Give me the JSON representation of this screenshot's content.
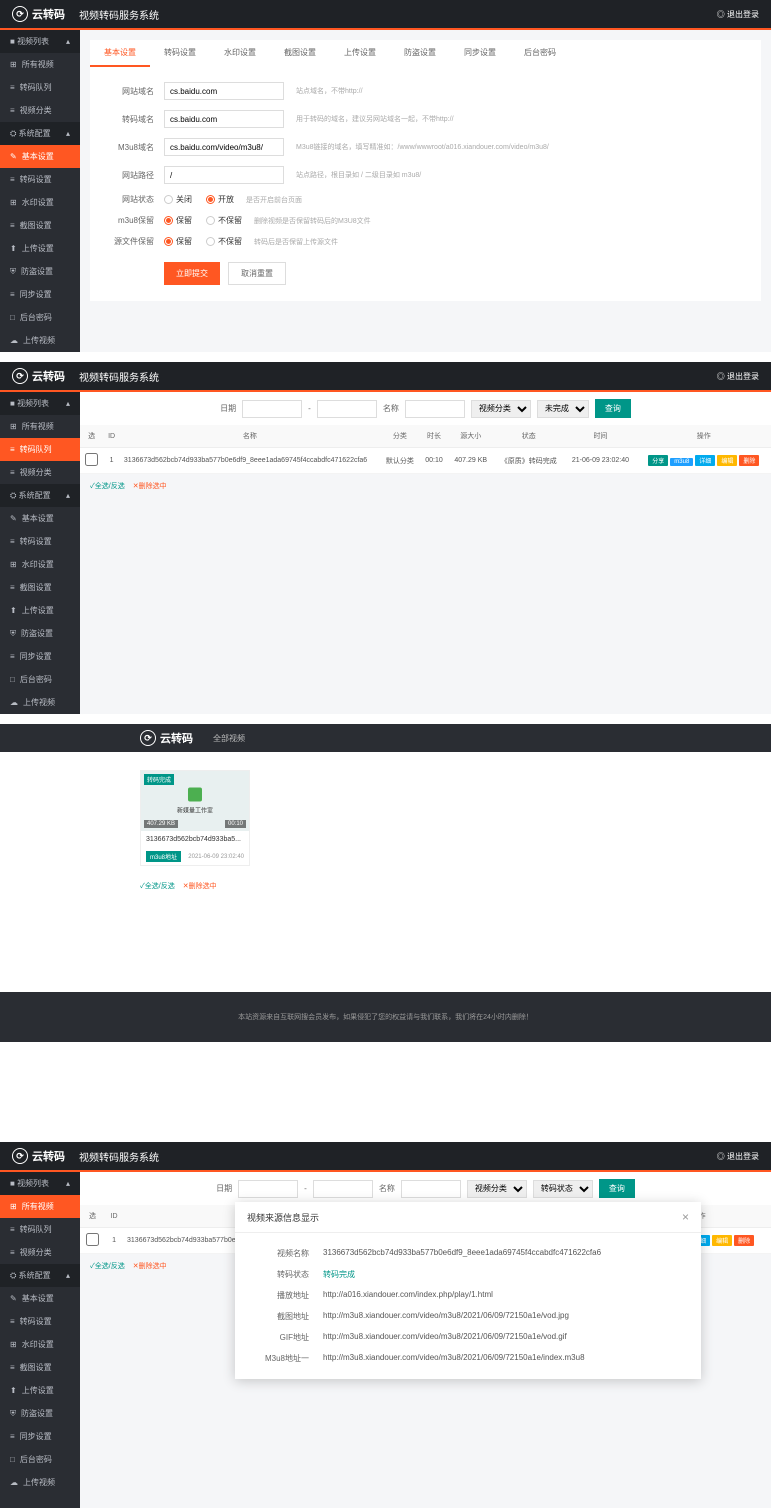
{
  "logo_text": "云转码",
  "sys_title": "视频转码服务系统",
  "logout": "◎ 退出登录",
  "sidebar": {
    "group1": "视频列表",
    "group2": "系统配置",
    "items1": [
      "所有视频",
      "转码队列",
      "视频分类"
    ],
    "items2": [
      "基本设置",
      "转码设置",
      "水印设置",
      "截图设置",
      "上传设置",
      "防盗设置",
      "同步设置",
      "后台密码",
      "上传视频"
    ]
  },
  "s1": {
    "tabs": [
      "基本设置",
      "转码设置",
      "水印设置",
      "截图设置",
      "上传设置",
      "防盗设置",
      "同步设置",
      "后台密码"
    ],
    "rows": [
      {
        "lbl": "网站域名",
        "val": "cs.baidu.com",
        "hint": "站点域名，不带http://"
      },
      {
        "lbl": "转码域名",
        "val": "cs.baidu.com",
        "hint": "用于转码的域名，建议另网站域名一起，不带http://"
      },
      {
        "lbl": "M3u8域名",
        "val": "cs.baidu.com/video/m3u8/",
        "hint": "M3u8链接的域名，填写精准如：/www/wwwroot/a016.xiandouer.com/video/m3u8/"
      },
      {
        "lbl": "网站路径",
        "val": "/",
        "hint": "站点路径，根目录如 / 二级目录如  m3u8/"
      }
    ],
    "radios": [
      {
        "lbl": "网站状态",
        "opts": [
          "关闭",
          "开放"
        ],
        "sel": 1,
        "hint": "是否开启前台页面"
      },
      {
        "lbl": "m3u8保留",
        "opts": [
          "保留",
          "不保留"
        ],
        "sel": 0,
        "hint": "删除视频是否保留转码后的M3U8文件"
      },
      {
        "lbl": "源文件保留",
        "opts": [
          "保留",
          "不保留"
        ],
        "sel": 0,
        "hint": "转码后是否保留上传源文件"
      }
    ],
    "btn_submit": "立即提交",
    "btn_reset": "取消重置"
  },
  "s2": {
    "filter": {
      "date": "日期",
      "sep": "-",
      "name": "名称",
      "cat": "视频分类",
      "status": "未完成",
      "search": "查询"
    },
    "table": {
      "headers": [
        "选",
        "ID",
        "名称",
        "分类",
        "时长",
        "源大小",
        "状态",
        "时间",
        "操作"
      ],
      "row": {
        "id": "1",
        "name": "3136673d562bcb74d933ba577b0e6df9_8eee1ada69745f4ccabdfc471622cfa6",
        "cat": "默认分类",
        "dur": "00:10",
        "size": "407.29 KB",
        "status": "《原质》转码完成",
        "time": "21-06-09 23:02:40",
        "ops": [
          "分享",
          "m3u8",
          "详细",
          "编辑",
          "删除"
        ]
      }
    },
    "sel_all": "✓全选/反选",
    "del_sel": "✕删除选中"
  },
  "s3": {
    "nav": "全部视频",
    "card": {
      "tag": "转码完成",
      "center_txt": "新媒量工作室",
      "size": "407.29 KB",
      "dur": "00:10",
      "title": "3136673d562bcb74d933ba5...",
      "foot_btn": "m3u8地址",
      "foot_date": "2021-06-09 23:02:40"
    },
    "footer": "本站资源来自互联网搜会员发布，如果侵犯了您的权益请与我们联系，我们将在24小时内删除！"
  },
  "s4": {
    "modal": {
      "title": "视频来源信息显示",
      "rows": [
        {
          "lbl": "视频名称",
          "val": "3136673d562bcb74d933ba577b0e6df9_8eee1ada69745f4ccabdfc471622cfa6"
        },
        {
          "lbl": "转码状态",
          "val": "转码完成",
          "grn": true
        },
        {
          "lbl": "播放地址",
          "val": "http://a016.xiandouer.com/index.php/play/1.html"
        },
        {
          "lbl": "截图地址",
          "val": "http://m3u8.xiandouer.com/video/m3u8/2021/06/09/72150a1e/vod.jpg"
        },
        {
          "lbl": "GIF地址",
          "val": "http://m3u8.xiandouer.com/video/m3u8/2021/06/09/72150a1e/vod.gif"
        },
        {
          "lbl": "M3u8地址一",
          "val": "http://m3u8.xiandouer.com/video/m3u8/2021/06/09/72150a1e/index.m3u8"
        }
      ]
    }
  }
}
